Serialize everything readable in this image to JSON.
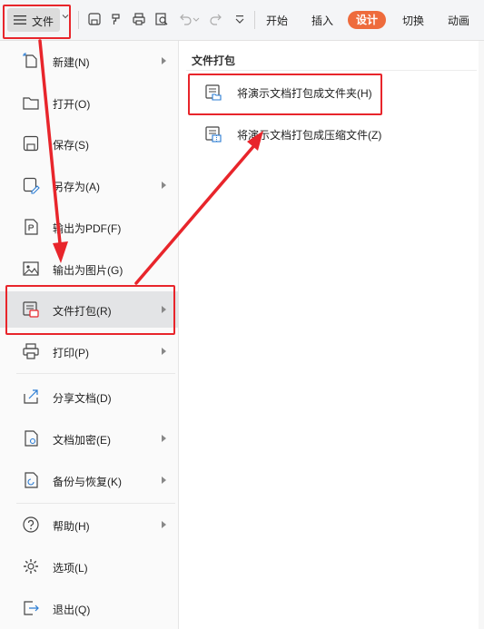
{
  "toolbar": {
    "file_label": "文件",
    "tabs": [
      "开始",
      "插入",
      "设计",
      "切换",
      "动画"
    ],
    "active_tab": "设计",
    "accent": "#ee6b3c"
  },
  "menu": {
    "items": [
      {
        "label": "新建(N)",
        "icon": "new-file-icon",
        "submenu": true
      },
      {
        "label": "打开(O)",
        "icon": "folder-icon",
        "submenu": false
      },
      {
        "label": "保存(S)",
        "icon": "save-icon",
        "submenu": false
      },
      {
        "label": "另存为(A)",
        "icon": "save-as-icon",
        "submenu": true
      },
      {
        "label": "输出为PDF(F)",
        "icon": "pdf-export-icon",
        "submenu": false
      },
      {
        "label": "输出为图片(G)",
        "icon": "image-export-icon",
        "submenu": false
      },
      {
        "label": "文件打包(R)",
        "icon": "package-icon",
        "submenu": true,
        "active": true
      },
      {
        "label": "打印(P)",
        "icon": "printer-icon",
        "submenu": true
      },
      {
        "label": "分享文档(D)",
        "icon": "share-icon",
        "submenu": false
      },
      {
        "label": "文档加密(E)",
        "icon": "encrypt-icon",
        "submenu": true
      },
      {
        "label": "备份与恢复(K)",
        "icon": "backup-icon",
        "submenu": true
      },
      {
        "label": "帮助(H)",
        "icon": "help-icon",
        "submenu": true
      },
      {
        "label": "选项(L)",
        "icon": "gear-icon",
        "submenu": false
      },
      {
        "label": "退出(Q)",
        "icon": "exit-icon",
        "submenu": false
      }
    ]
  },
  "panel": {
    "title": "文件打包",
    "items": [
      {
        "label": "将演示文档打包成文件夹(H)",
        "icon": "package-folder-icon"
      },
      {
        "label": "将演示文档打包成压缩文件(Z)",
        "icon": "package-zip-icon"
      }
    ]
  },
  "annotation_color": "#e8252b"
}
